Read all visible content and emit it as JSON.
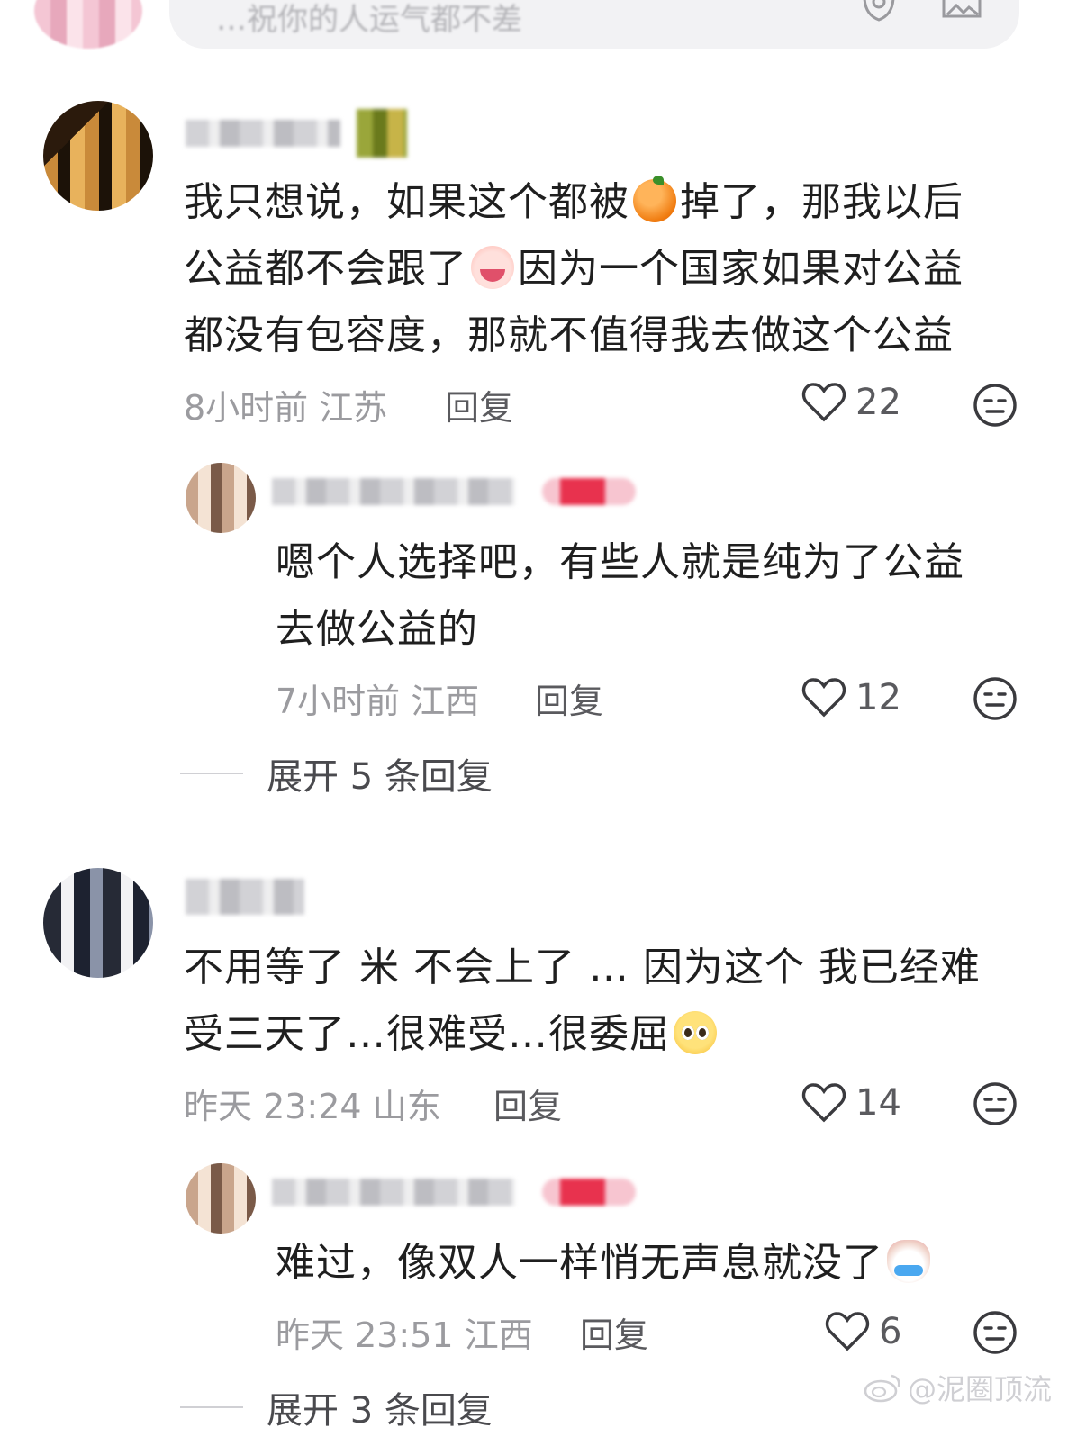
{
  "input_bar": {
    "placeholder": "…祝你的人运气都不差"
  },
  "comments": [
    {
      "text_parts": [
        "我只想说，如果这个都被",
        "掉了，那我以后",
        "公益都不会跟了",
        "因为一个国家如果对公益",
        "都没有包容度，那就不值得我去做这个公益"
      ],
      "emojis": [
        "orange-emoji",
        "crying-face-emoji"
      ],
      "time": "8小时前",
      "location": "江苏",
      "reply_label": "回复",
      "likes": "22",
      "reply": {
        "text": "嗯个人选择吧，有些人就是纯为了公益去做公益的",
        "text_line1": "嗯个人选择吧，有些人就是纯为了公益",
        "text_line2": "去做公益的",
        "time": "7小时前",
        "location": "江西",
        "reply_label": "回复",
        "likes": "12"
      },
      "expand_label": "展开 5 条回复"
    },
    {
      "text_line1": "不用等了  米  不会上了 … 因为这个  我已经难",
      "text_line2": "受三天了…很难受…很委屈",
      "emojis": [
        "pleading-face-emoji"
      ],
      "time": "昨天 23:24",
      "location": "山东",
      "reply_label": "回复",
      "likes": "14",
      "reply": {
        "text": "难过，像双人一样悄无声息就没了",
        "time": "昨天 23:51",
        "location": "江西",
        "reply_label": "回复",
        "likes": "6",
        "emojis": [
          "crying-dog-emoji"
        ]
      },
      "expand_label": "展开 3 条回复"
    }
  ],
  "watermark": {
    "text": "@泥圈顶流"
  },
  "colors": {
    "text": "#1f1f1f",
    "meta": "#9b9b9f",
    "pill": "#f2f2f4"
  }
}
